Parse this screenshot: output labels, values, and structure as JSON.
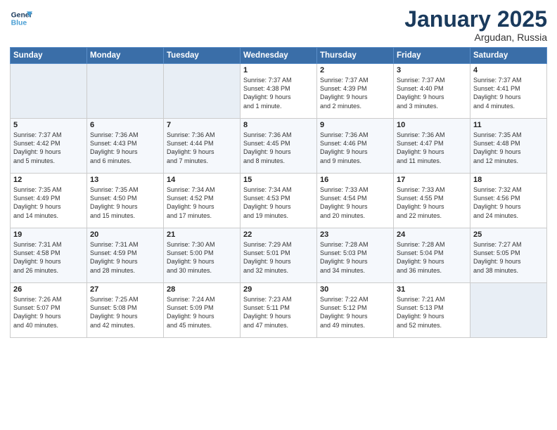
{
  "logo": {
    "line1": "General",
    "line2": "Blue"
  },
  "title": "January 2025",
  "subtitle": "Argudan, Russia",
  "weekdays": [
    "Sunday",
    "Monday",
    "Tuesday",
    "Wednesday",
    "Thursday",
    "Friday",
    "Saturday"
  ],
  "weeks": [
    [
      {
        "day": "",
        "detail": ""
      },
      {
        "day": "",
        "detail": ""
      },
      {
        "day": "",
        "detail": ""
      },
      {
        "day": "1",
        "detail": "Sunrise: 7:37 AM\nSunset: 4:38 PM\nDaylight: 9 hours\nand 1 minute."
      },
      {
        "day": "2",
        "detail": "Sunrise: 7:37 AM\nSunset: 4:39 PM\nDaylight: 9 hours\nand 2 minutes."
      },
      {
        "day": "3",
        "detail": "Sunrise: 7:37 AM\nSunset: 4:40 PM\nDaylight: 9 hours\nand 3 minutes."
      },
      {
        "day": "4",
        "detail": "Sunrise: 7:37 AM\nSunset: 4:41 PM\nDaylight: 9 hours\nand 4 minutes."
      }
    ],
    [
      {
        "day": "5",
        "detail": "Sunrise: 7:37 AM\nSunset: 4:42 PM\nDaylight: 9 hours\nand 5 minutes."
      },
      {
        "day": "6",
        "detail": "Sunrise: 7:36 AM\nSunset: 4:43 PM\nDaylight: 9 hours\nand 6 minutes."
      },
      {
        "day": "7",
        "detail": "Sunrise: 7:36 AM\nSunset: 4:44 PM\nDaylight: 9 hours\nand 7 minutes."
      },
      {
        "day": "8",
        "detail": "Sunrise: 7:36 AM\nSunset: 4:45 PM\nDaylight: 9 hours\nand 8 minutes."
      },
      {
        "day": "9",
        "detail": "Sunrise: 7:36 AM\nSunset: 4:46 PM\nDaylight: 9 hours\nand 9 minutes."
      },
      {
        "day": "10",
        "detail": "Sunrise: 7:36 AM\nSunset: 4:47 PM\nDaylight: 9 hours\nand 11 minutes."
      },
      {
        "day": "11",
        "detail": "Sunrise: 7:35 AM\nSunset: 4:48 PM\nDaylight: 9 hours\nand 12 minutes."
      }
    ],
    [
      {
        "day": "12",
        "detail": "Sunrise: 7:35 AM\nSunset: 4:49 PM\nDaylight: 9 hours\nand 14 minutes."
      },
      {
        "day": "13",
        "detail": "Sunrise: 7:35 AM\nSunset: 4:50 PM\nDaylight: 9 hours\nand 15 minutes."
      },
      {
        "day": "14",
        "detail": "Sunrise: 7:34 AM\nSunset: 4:52 PM\nDaylight: 9 hours\nand 17 minutes."
      },
      {
        "day": "15",
        "detail": "Sunrise: 7:34 AM\nSunset: 4:53 PM\nDaylight: 9 hours\nand 19 minutes."
      },
      {
        "day": "16",
        "detail": "Sunrise: 7:33 AM\nSunset: 4:54 PM\nDaylight: 9 hours\nand 20 minutes."
      },
      {
        "day": "17",
        "detail": "Sunrise: 7:33 AM\nSunset: 4:55 PM\nDaylight: 9 hours\nand 22 minutes."
      },
      {
        "day": "18",
        "detail": "Sunrise: 7:32 AM\nSunset: 4:56 PM\nDaylight: 9 hours\nand 24 minutes."
      }
    ],
    [
      {
        "day": "19",
        "detail": "Sunrise: 7:31 AM\nSunset: 4:58 PM\nDaylight: 9 hours\nand 26 minutes."
      },
      {
        "day": "20",
        "detail": "Sunrise: 7:31 AM\nSunset: 4:59 PM\nDaylight: 9 hours\nand 28 minutes."
      },
      {
        "day": "21",
        "detail": "Sunrise: 7:30 AM\nSunset: 5:00 PM\nDaylight: 9 hours\nand 30 minutes."
      },
      {
        "day": "22",
        "detail": "Sunrise: 7:29 AM\nSunset: 5:01 PM\nDaylight: 9 hours\nand 32 minutes."
      },
      {
        "day": "23",
        "detail": "Sunrise: 7:28 AM\nSunset: 5:03 PM\nDaylight: 9 hours\nand 34 minutes."
      },
      {
        "day": "24",
        "detail": "Sunrise: 7:28 AM\nSunset: 5:04 PM\nDaylight: 9 hours\nand 36 minutes."
      },
      {
        "day": "25",
        "detail": "Sunrise: 7:27 AM\nSunset: 5:05 PM\nDaylight: 9 hours\nand 38 minutes."
      }
    ],
    [
      {
        "day": "26",
        "detail": "Sunrise: 7:26 AM\nSunset: 5:07 PM\nDaylight: 9 hours\nand 40 minutes."
      },
      {
        "day": "27",
        "detail": "Sunrise: 7:25 AM\nSunset: 5:08 PM\nDaylight: 9 hours\nand 42 minutes."
      },
      {
        "day": "28",
        "detail": "Sunrise: 7:24 AM\nSunset: 5:09 PM\nDaylight: 9 hours\nand 45 minutes."
      },
      {
        "day": "29",
        "detail": "Sunrise: 7:23 AM\nSunset: 5:11 PM\nDaylight: 9 hours\nand 47 minutes."
      },
      {
        "day": "30",
        "detail": "Sunrise: 7:22 AM\nSunset: 5:12 PM\nDaylight: 9 hours\nand 49 minutes."
      },
      {
        "day": "31",
        "detail": "Sunrise: 7:21 AM\nSunset: 5:13 PM\nDaylight: 9 hours\nand 52 minutes."
      },
      {
        "day": "",
        "detail": ""
      }
    ]
  ]
}
